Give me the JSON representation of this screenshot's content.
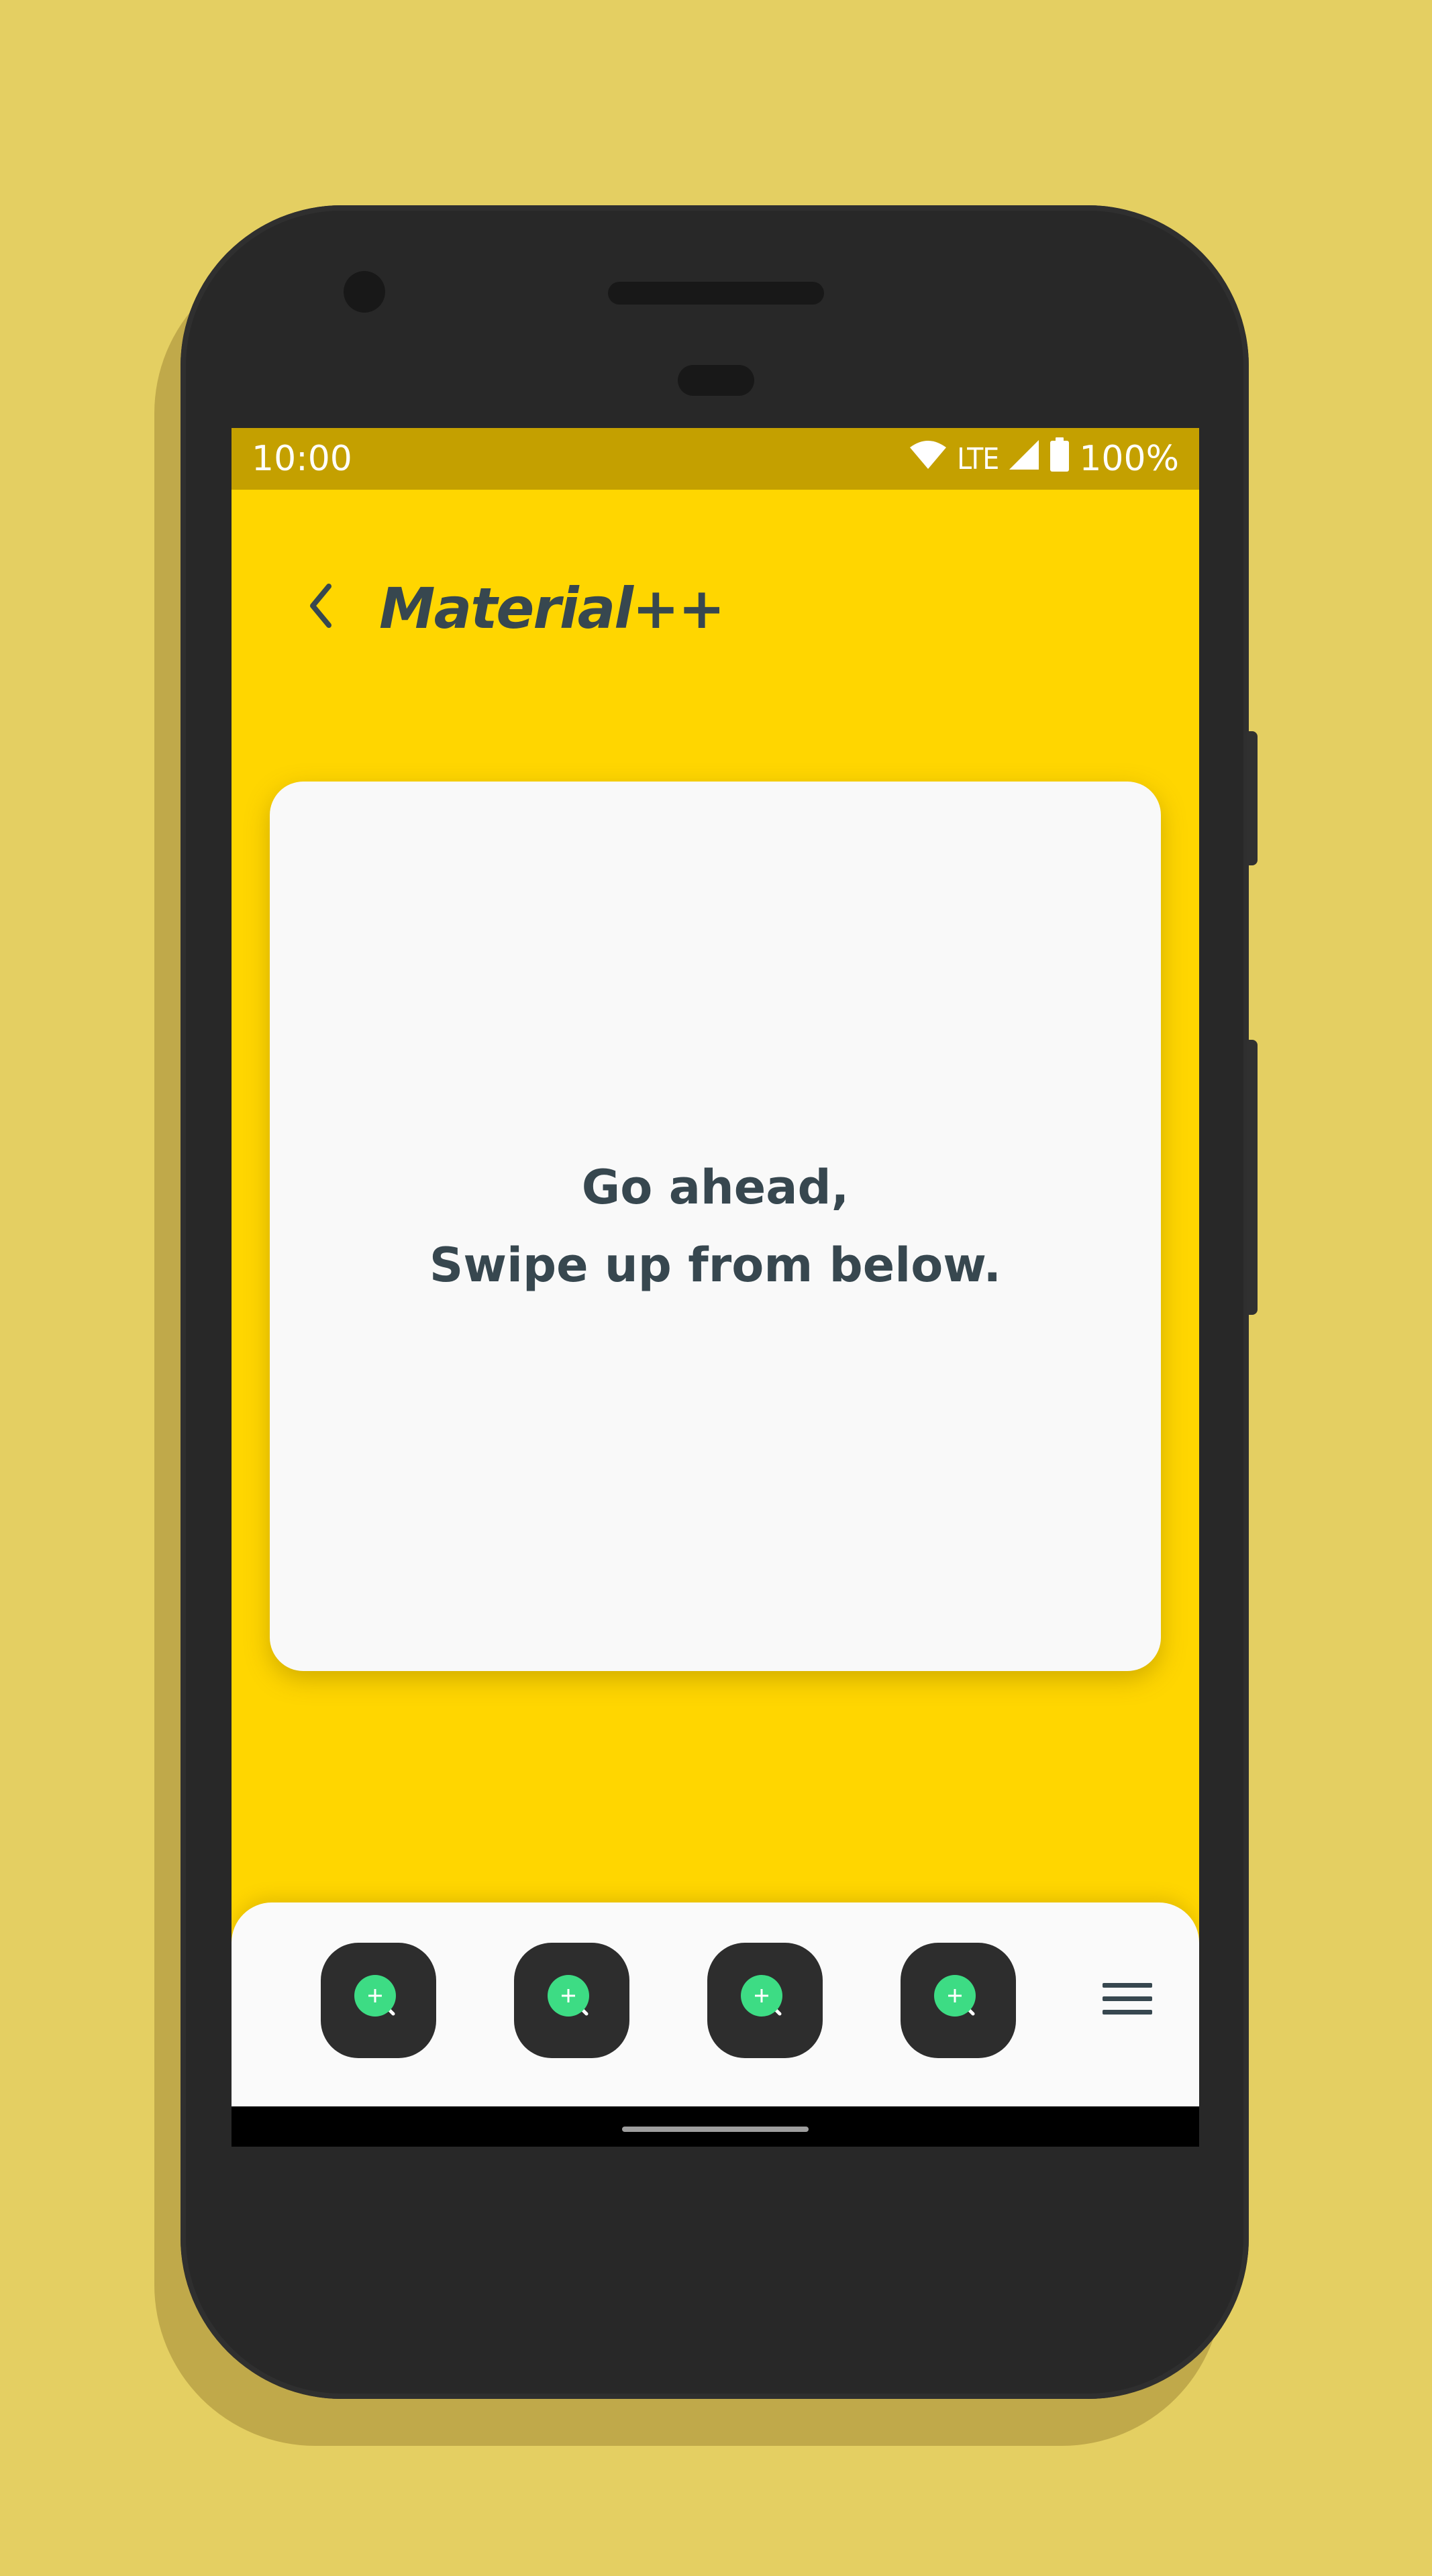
{
  "status_bar": {
    "time": "10:00",
    "network": "LTE",
    "battery": "100%",
    "icons": [
      "wifi-icon",
      "cell-signal-icon",
      "battery-icon"
    ]
  },
  "app_bar": {
    "title": "Material++",
    "back_icon": "chevron-left-icon"
  },
  "card": {
    "line1": "Go ahead,",
    "line2": "Swipe up from below."
  },
  "dock": {
    "items": [
      {
        "icon": "add-search-icon"
      },
      {
        "icon": "add-search-icon"
      },
      {
        "icon": "add-search-icon"
      },
      {
        "icon": "add-search-icon"
      }
    ],
    "menu_icon": "hamburger-menu-icon"
  },
  "colors": {
    "background": "#E4CF62",
    "screen": "#FFD600",
    "status_bar": "#C4A000",
    "card": "#F9F9F9",
    "text": "#37474F",
    "dock_button": "#2D2D2D",
    "accent_green": "#3DDC84"
  }
}
